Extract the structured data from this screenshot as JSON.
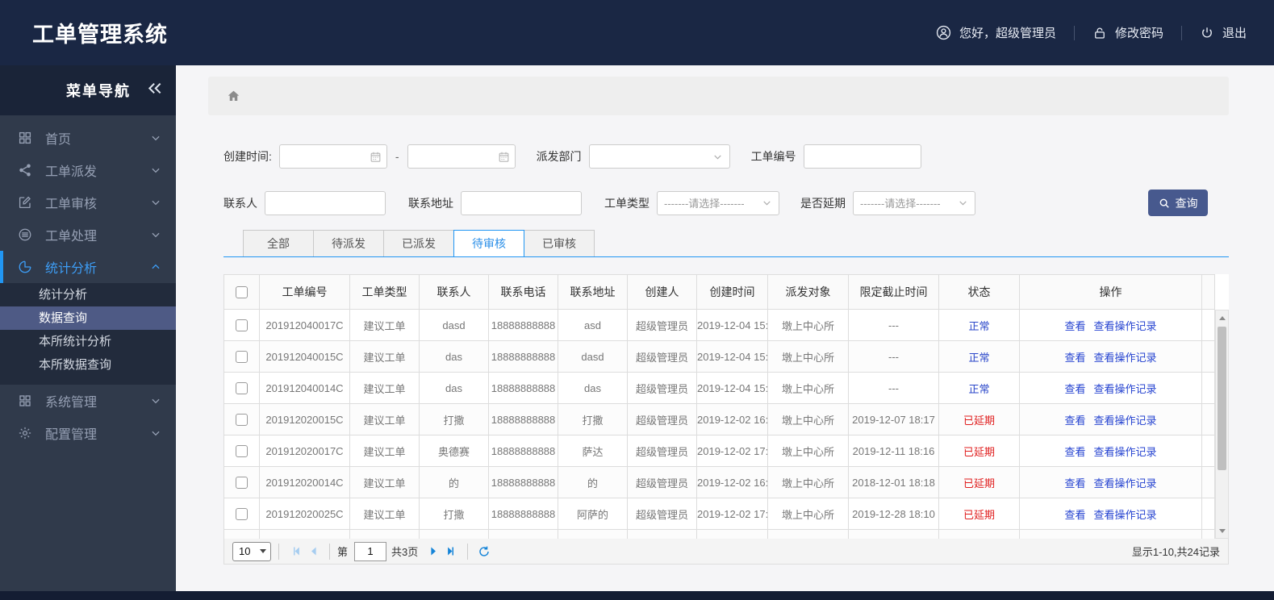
{
  "app_title": "工单管理系统",
  "topbar": {
    "greeting": "您好，超级管理员",
    "change_password": "修改密码",
    "logout": "退出"
  },
  "sidebar": {
    "title": "菜单导航",
    "items": [
      {
        "key": "home",
        "icon": "dashboard-icon",
        "label": "首页"
      },
      {
        "key": "dispatch",
        "icon": "share-icon",
        "label": "工单派发"
      },
      {
        "key": "review",
        "icon": "edit-icon",
        "label": "工单审核"
      },
      {
        "key": "process",
        "icon": "layers-icon",
        "label": "工单处理"
      },
      {
        "key": "stats",
        "icon": "pie-chart-icon",
        "label": "统计分析",
        "active": true,
        "expanded": true,
        "children": [
          {
            "key": "stats-analysis",
            "label": "统计分析"
          },
          {
            "key": "data-query",
            "label": "数据查询",
            "active": true
          },
          {
            "key": "branch-stats",
            "label": "本所统计分析"
          },
          {
            "key": "branch-data-query",
            "label": "本所数据查询"
          }
        ]
      },
      {
        "key": "system",
        "icon": "grid-icon",
        "label": "系统管理"
      },
      {
        "key": "config",
        "icon": "gear-icon",
        "label": "配置管理"
      }
    ]
  },
  "filters": {
    "create_time_label": "创建时间:",
    "range_separator": "-",
    "dispatch_dept_label": "派发部门",
    "order_no_label": "工单编号",
    "contact_label": "联系人",
    "address_label": "联系地址",
    "order_type_label": "工单类型",
    "delay_label": "是否延期",
    "select_placeholder": "-------请选择-------",
    "search_button": "查询"
  },
  "tabs": [
    {
      "key": "all",
      "label": "全部"
    },
    {
      "key": "to-dispatch",
      "label": "待派发"
    },
    {
      "key": "dispatched",
      "label": "已派发"
    },
    {
      "key": "to-review",
      "label": "待审核",
      "active": true
    },
    {
      "key": "reviewed",
      "label": "已审核"
    }
  ],
  "table": {
    "columns": [
      "工单编号",
      "工单类型",
      "联系人",
      "联系电话",
      "联系地址",
      "创建人",
      "创建时间",
      "派发对象",
      "限定截止时间",
      "状态",
      "操作"
    ],
    "actions": [
      "查看",
      "查看操作记录"
    ],
    "rows": [
      {
        "order_no": "201912040017C",
        "type": "建议工单",
        "contact": "dasd",
        "phone": "18888888888",
        "address": "asd",
        "creator": "超级管理员",
        "created": "2019-12-04 15:",
        "target": "墩上中心所",
        "deadline": "---",
        "status": "正常",
        "status_color": "normal"
      },
      {
        "order_no": "201912040015C",
        "type": "建议工单",
        "contact": "das",
        "phone": "18888888888",
        "address": "dasd",
        "creator": "超级管理员",
        "created": "2019-12-04 15:",
        "target": "墩上中心所",
        "deadline": "---",
        "status": "正常",
        "status_color": "normal"
      },
      {
        "order_no": "201912040014C",
        "type": "建议工单",
        "contact": "das",
        "phone": "18888888888",
        "address": "das",
        "creator": "超级管理员",
        "created": "2019-12-04 15:",
        "target": "墩上中心所",
        "deadline": "---",
        "status": "正常",
        "status_color": "normal"
      },
      {
        "order_no": "201912020015C",
        "type": "建议工单",
        "contact": "打撒",
        "phone": "18888888888",
        "address": "打撒",
        "creator": "超级管理员",
        "created": "2019-12-02 16:",
        "target": "墩上中心所",
        "deadline": "2019-12-07 18:17",
        "status": "已延期",
        "status_color": "delayed"
      },
      {
        "order_no": "201912020017C",
        "type": "建议工单",
        "contact": "奥德赛",
        "phone": "18888888888",
        "address": "萨达",
        "creator": "超级管理员",
        "created": "2019-12-02 17:",
        "target": "墩上中心所",
        "deadline": "2019-12-11 18:16",
        "status": "已延期",
        "status_color": "delayed"
      },
      {
        "order_no": "201912020014C",
        "type": "建议工单",
        "contact": "的",
        "phone": "18888888888",
        "address": "的",
        "creator": "超级管理员",
        "created": "2019-12-02 16:",
        "target": "墩上中心所",
        "deadline": "2018-12-01 18:18",
        "status": "已延期",
        "status_color": "delayed"
      },
      {
        "order_no": "201912020025C",
        "type": "建议工单",
        "contact": "打撒",
        "phone": "18888888888",
        "address": "阿萨的",
        "creator": "超级管理员",
        "created": "2019-12-02 17:",
        "target": "墩上中心所",
        "deadline": "2019-12-28 18:10",
        "status": "已延期",
        "status_color": "delayed"
      }
    ]
  },
  "pagination": {
    "page_size": "10",
    "page_prefix": "第",
    "current_page": "1",
    "total_pages": "共3页",
    "summary": "显示1-10,共24记录"
  },
  "colors": {
    "accent": "#2196f3",
    "header_bg": "#1a2744",
    "sidebar_bg": "#303a4b",
    "active_submenu_bg": "#4e5a85",
    "search_button_bg": "#47598e",
    "status_normal": "#2a46c9",
    "status_delayed": "#e01e1e",
    "link": "#2442d0"
  }
}
